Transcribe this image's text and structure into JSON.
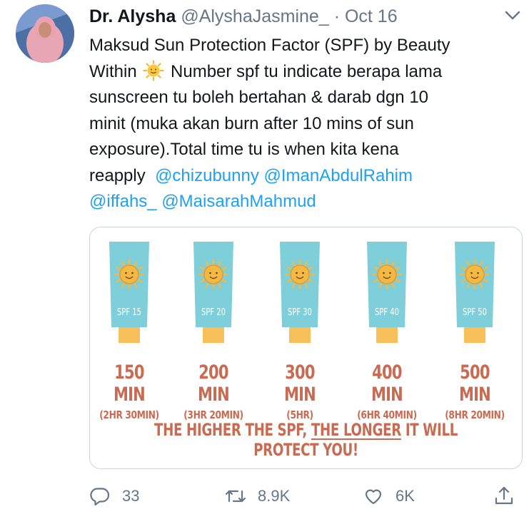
{
  "tweet": {
    "author_name": "Dr. Alysha",
    "handle": "@AlyshaJasmine_",
    "separator": "·",
    "date": "Oct 16",
    "text_parts": {
      "line_1": "Maksud Sun Protection Factor (SPF) by Beauty",
      "line_2_a": "Within",
      "line_2_b": "Number spf tu indicate berapa lama",
      "line_3": "sunscreen tu boleh bertahan & darab dgn 10",
      "line_4": "minit (muka akan burn after 10 mins of sun",
      "line_5": "exposure).Total time tu is when kita kena",
      "line_6_a": "reapply",
      "mentions": [
        "@chizubunny",
        "@ImanAbdulRahim",
        "@iffahs_",
        "@MaisarahMahmud"
      ]
    },
    "emoji_icon": "sun-emoji-icon"
  },
  "infographic": {
    "tubes": [
      {
        "spf": "SPF 15",
        "minutes": "150 MIN",
        "hours": "(2HR 30MIN)"
      },
      {
        "spf": "SPF 20",
        "minutes": "200 MIN",
        "hours": "(3HR 20MIN)"
      },
      {
        "spf": "SPF 30",
        "minutes": "300 MIN",
        "hours": "(5HR)"
      },
      {
        "spf": "SPF 40",
        "minutes": "400 MIN",
        "hours": "(6HR 40MIN)"
      },
      {
        "spf": "SPF 50",
        "minutes": "500 MIN",
        "hours": "(8HR 20MIN)"
      }
    ],
    "footer_a": "THE HIGHER THE SPF,",
    "footer_b": "THE LONGER",
    "footer_c": "IT WILL PROTECT YOU!",
    "colors": {
      "tube": "#7ecfd9",
      "cap": "#f7c05a",
      "sun": "#f4b942",
      "text": "#c96b52"
    }
  },
  "actions": {
    "replies": "33",
    "retweets": "8.9K",
    "likes": "6K"
  }
}
